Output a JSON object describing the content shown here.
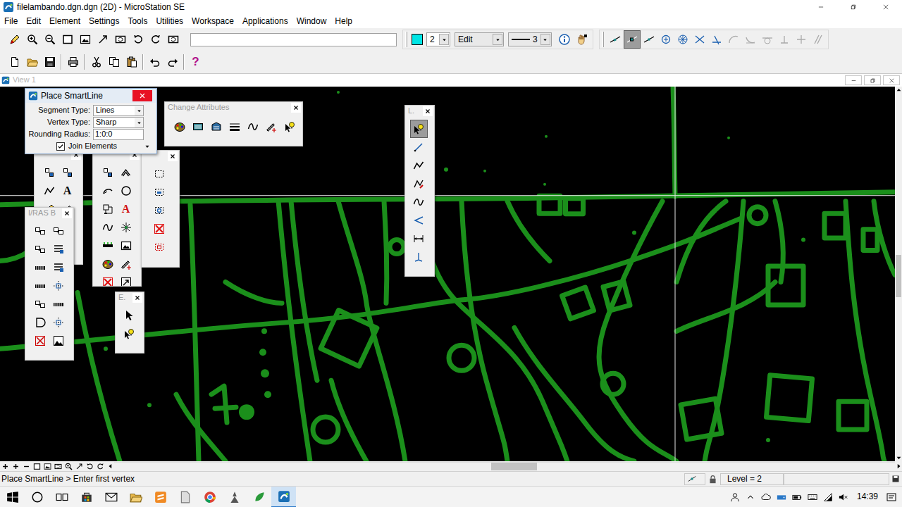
{
  "window": {
    "title": "filelambando.dgn.dgn (2D) - MicroStation SE"
  },
  "menu": [
    "File",
    "Edit",
    "Element",
    "Settings",
    "Tools",
    "Utilities",
    "Workspace",
    "Applications",
    "Window",
    "Help"
  ],
  "attributes": {
    "color": "#00e5e5",
    "color_number": "2",
    "level": "Edit",
    "weight": "3"
  },
  "snaps": [
    {
      "selected": false,
      "disabled": false
    },
    {
      "selected": true,
      "disabled": false
    },
    {
      "selected": false,
      "disabled": false
    },
    {
      "selected": false,
      "disabled": false
    },
    {
      "selected": false,
      "disabled": false
    },
    {
      "selected": false,
      "disabled": false
    },
    {
      "selected": false,
      "disabled": false
    },
    {
      "selected": false,
      "disabled": true
    },
    {
      "selected": false,
      "disabled": true
    },
    {
      "selected": false,
      "disabled": true
    },
    {
      "selected": false,
      "disabled": true
    },
    {
      "selected": false,
      "disabled": true
    },
    {
      "selected": false,
      "disabled": true
    }
  ],
  "tool_glyphs": {
    "text_tool": "A",
    "help": "?"
  },
  "view": {
    "title": "View 1"
  },
  "smartline_dialog": {
    "title": "Place SmartLine",
    "fields": [
      {
        "label": "Segment Type:",
        "value": "Lines",
        "kind": "dropdown"
      },
      {
        "label": "Vertex Type:",
        "value": "Sharp",
        "kind": "dropdown"
      },
      {
        "label": "Rounding Radius:",
        "value": "1:0:0",
        "kind": "input"
      }
    ],
    "join_elements": {
      "label": "Join Elements",
      "checked": true
    }
  },
  "palettes": {
    "change_attributes": {
      "title": "Change Attributes"
    },
    "linear": {
      "title": "L.",
      "tools": [
        {
          "selected": true
        },
        {
          "selected": false
        },
        {
          "selected": false
        },
        {
          "selected": false
        },
        {
          "selected": false
        },
        {
          "selected": false
        },
        {
          "selected": false
        },
        {
          "selected": false
        }
      ]
    },
    "iras": {
      "title": "I/RAS B"
    },
    "element_selection": {
      "title": "E."
    }
  },
  "status_bar": {
    "prompt": "Place SmartLine > Enter first vertex",
    "level": "Level = 2"
  },
  "taskbar": {
    "time": "14:39"
  }
}
